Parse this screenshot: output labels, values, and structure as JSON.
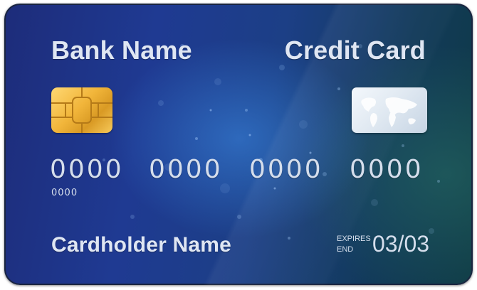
{
  "card": {
    "bank_name": "Bank Name",
    "card_type": "Credit Card",
    "number_groups": [
      "0000",
      "0000",
      "0000",
      "0000"
    ],
    "small_number": "0000",
    "cardholder": "Cardholder Name",
    "expires_label_top": "EXPIRES",
    "expires_label_bottom": "END",
    "expiry": "03/03"
  },
  "colors": {
    "card_blue": "#1f3a92",
    "card_teal": "#0f3a45",
    "text": "#dfe6f3",
    "chip_gold": "#f1b53a"
  },
  "icons": [
    "chip-icon",
    "hologram-world-map-icon"
  ]
}
